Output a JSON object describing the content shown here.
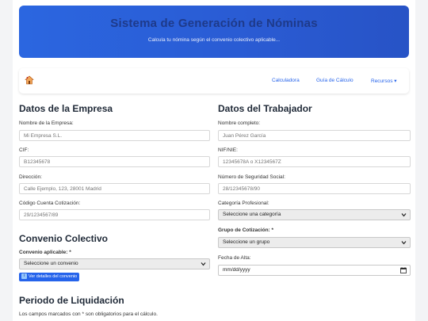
{
  "header": {
    "title": "Sistema de Generación de Nóminas",
    "subtitle": "Calcula tu nómina según el convenio colectivo aplicable..."
  },
  "nav": {
    "home_icon": "home-icon",
    "links": [
      "Calculadora",
      "Guía de Cálculo",
      "Recursos ▾"
    ]
  },
  "empresa": {
    "title": "Datos de la Empresa",
    "nombre_label": "Nombre de la Empresa:",
    "nombre_placeholder": "Mi Empresa S.L.",
    "cif_label": "CIF:",
    "cif_placeholder": "B12345678",
    "direccion_label": "Dirección:",
    "direccion_placeholder": "Calle Ejemplo, 123, 28001 Madrid",
    "ccc_label": "Código Cuenta Cotización:",
    "ccc_placeholder": "29/1234567/89"
  },
  "trabajador": {
    "title": "Datos del Trabajador",
    "nombre_label": "Nombre completo:",
    "nombre_placeholder": "Juan Pérez García",
    "nif_label": "NIF/NIE:",
    "nif_placeholder": "12345678A o X1234567Z",
    "nss_label": "Número de Seguridad Social:",
    "nss_placeholder": "28/12345678/90",
    "categoria_label": "Categoría Profesional:",
    "categoria_value": "Seleccione una categoría",
    "grupo_label": "Grupo de Cotización: *",
    "grupo_value": "Seleccione un grupo",
    "fecha_label": "Fecha de Alta:",
    "fecha_value": "mm/dd/yyyy"
  },
  "convenio": {
    "title": "Convenio Colectivo",
    "aplicable_label": "Convenio aplicable: *",
    "aplicable_value": "Seleccione un convenio",
    "detalles_button": "Ver detalles del convenio"
  },
  "liquidacion": {
    "title": "Periodo de Liquidación",
    "note": "Los campos marcados con * son obligatorios para el cálculo."
  },
  "colors": {
    "header_gradient_start": "#2b66e0",
    "header_title": "#1e3a8a",
    "link": "#2563eb",
    "button": "#2563eb"
  }
}
